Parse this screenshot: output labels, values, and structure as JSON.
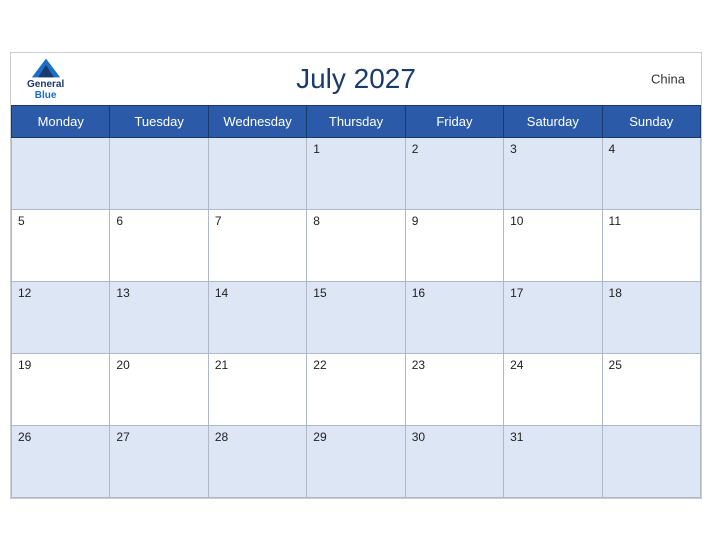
{
  "header": {
    "title": "July 2027",
    "country": "China",
    "logo": {
      "general": "General",
      "blue": "Blue"
    }
  },
  "weekdays": [
    "Monday",
    "Tuesday",
    "Wednesday",
    "Thursday",
    "Friday",
    "Saturday",
    "Sunday"
  ],
  "weeks": [
    [
      null,
      null,
      null,
      1,
      2,
      3,
      4
    ],
    [
      5,
      6,
      7,
      8,
      9,
      10,
      11
    ],
    [
      12,
      13,
      14,
      15,
      16,
      17,
      18
    ],
    [
      19,
      20,
      21,
      22,
      23,
      24,
      25
    ],
    [
      26,
      27,
      28,
      29,
      30,
      31,
      null
    ]
  ]
}
